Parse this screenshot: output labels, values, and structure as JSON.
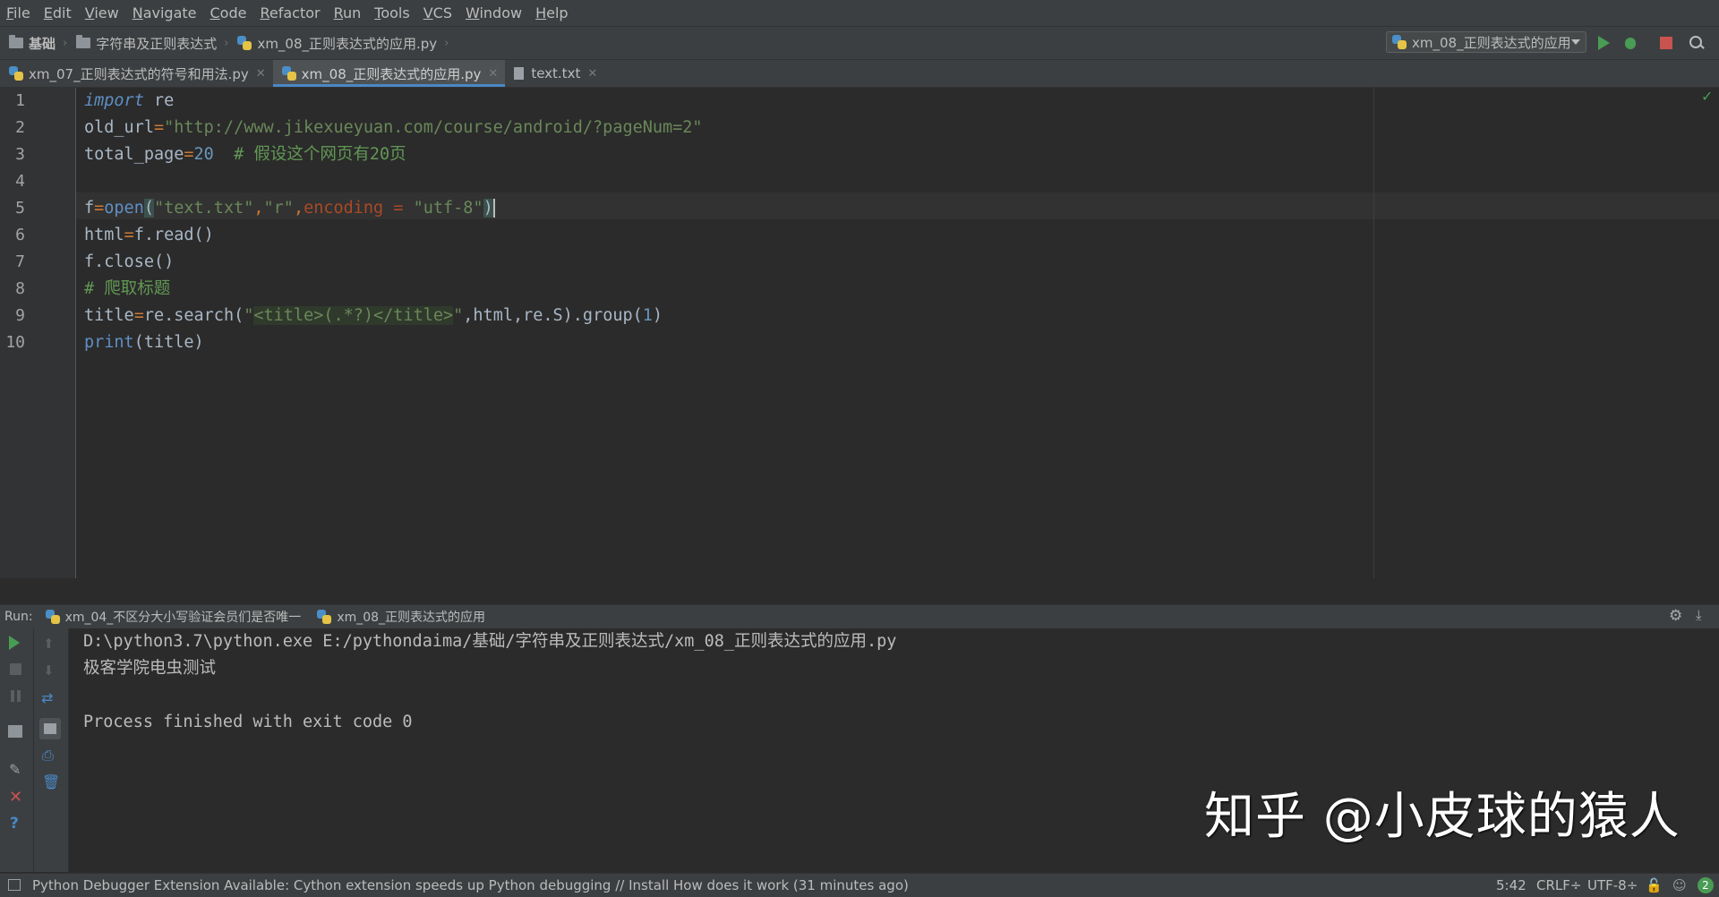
{
  "menu": [
    {
      "mn": "F",
      "rest": "ile"
    },
    {
      "mn": "E",
      "rest": "dit"
    },
    {
      "mn": "V",
      "rest": "iew"
    },
    {
      "mn": "N",
      "rest": "avigate"
    },
    {
      "mn": "C",
      "rest": "ode"
    },
    {
      "mn": "R",
      "rest": "efactor"
    },
    {
      "mn": "R",
      "rest": "un"
    },
    {
      "mn": "T",
      "rest": "ools"
    },
    {
      "mn": "V",
      "rest": "CS"
    },
    {
      "mn": "W",
      "rest": "indow"
    },
    {
      "mn": "H",
      "rest": "elp"
    }
  ],
  "breadcrumb": [
    "基础",
    "字符串及正则表达式",
    "xm_08_正则表达式的应用.py"
  ],
  "run_config": "xm_08_正则表达式的应用",
  "tabs": [
    {
      "label": "xm_07_正则表达式的符号和用法.py",
      "active": false
    },
    {
      "label": "xm_08_正则表达式的应用.py",
      "active": true
    },
    {
      "label": "text.txt",
      "active": false
    }
  ],
  "line_numbers": [
    "1",
    "2",
    "3",
    "4",
    "5",
    "6",
    "7",
    "8",
    "9",
    "10"
  ],
  "code": {
    "l1_kw": "import",
    "l1_rest": " re",
    "l2_a": "old_url",
    "l2_eq": "=",
    "l2_str": "\"http://www.jikexueyuan.com/course/android/?pageNum=2\"",
    "l3_a": "total_page",
    "l3_eq": "=",
    "l3_num": "20",
    "l3_cm": "  # 假设这个网页有20页",
    "l5_a": "f",
    "l5_eq": "=",
    "l5_fn": "open",
    "l5_p1": "(",
    "l5_s1": "\"text.txt\"",
    "l5_c1": ",",
    "l5_s2": "\"r\"",
    "l5_c2": ",",
    "l5_kw": "encoding = ",
    "l5_s3": "\"utf-8\"",
    "l5_p2": ")",
    "l6": "html=f.read()",
    "l6_a": "html",
    "l6_eq": "=",
    "l6_b": "f.read()",
    "l7": "f.close()",
    "l8": "# 爬取标题",
    "l9_a": "title",
    "l9_eq": "=",
    "l9_b": "re.search(",
    "l9_q1": "\"",
    "l9_s": "<title>(.*?)</title>",
    "l9_q2": "\"",
    "l9_c": ",html,re.S).group(",
    "l9_num": "1",
    "l9_e": ")",
    "l10_fn": "print",
    "l10_rest": "(title)"
  },
  "run_panel": {
    "label": "Run:",
    "tabs": [
      "xm_04_不区分大小写验证会员们是否唯一",
      "xm_08_正则表达式的应用"
    ]
  },
  "console": [
    "D:\\python3.7\\python.exe E:/pythondaima/基础/字符串及正则表达式/xm_08_正则表达式的应用.py",
    "极客学院电虫测试",
    "",
    "Process finished with exit code 0"
  ],
  "status": {
    "message": "Python Debugger Extension Available: Cython extension speeds up Python debugging // Install How does it work (31 minutes ago)",
    "position": "5:42",
    "line_sep": "CRLF÷",
    "encoding": "UTF-8÷",
    "notifications": "2"
  },
  "watermark": "知乎 @小皮球的猿人",
  "colors": {
    "keyword": "#cc7832",
    "string": "#6a8759",
    "number": "#6897bb",
    "comment": "#629755",
    "accent": "#4a88c7"
  }
}
